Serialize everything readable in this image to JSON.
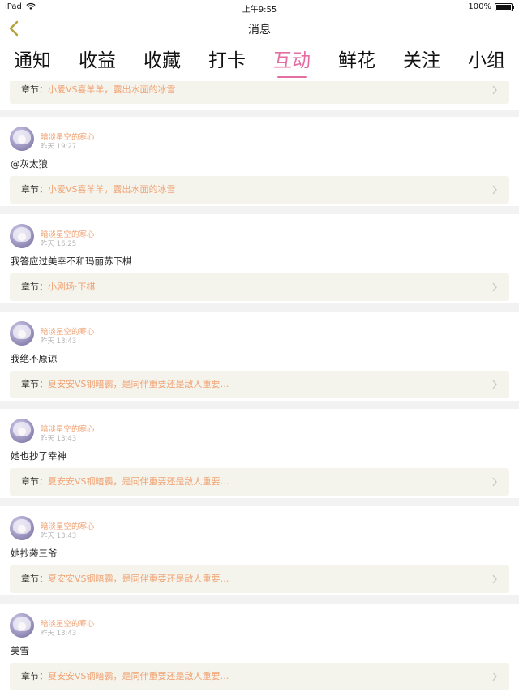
{
  "status_bar": {
    "carrier": "iPad",
    "time": "上午9:55",
    "battery": "100%"
  },
  "nav": {
    "title": "消息",
    "back_icon": "chevron-left-icon"
  },
  "tabs": [
    {
      "label": "通知",
      "active": false
    },
    {
      "label": "收益",
      "active": false
    },
    {
      "label": "收藏",
      "active": false
    },
    {
      "label": "打卡",
      "active": false
    },
    {
      "label": "互动",
      "active": true
    },
    {
      "label": "鲜花",
      "active": false
    },
    {
      "label": "关注",
      "active": false
    },
    {
      "label": "小组",
      "active": false
    }
  ],
  "colors": {
    "accent": "#e46ea1",
    "chapter_text": "#f0a273",
    "chapter_bg": "#f5f4ec"
  },
  "partial_card": {
    "chapter_prefix": "章节：",
    "chapter_name": "小爱VS喜羊羊，露出水面的冰雪"
  },
  "messages": [
    {
      "username": "暗淡星空的寒心",
      "time": "昨天 19:27",
      "content": "@灰太狼",
      "chapter_prefix": "章节：",
      "chapter_name": "小爱VS喜羊羊，露出水面的冰雪"
    },
    {
      "username": "暗淡星空的寒心",
      "time": "昨天 16:25",
      "content": "我答应过美幸不和玛丽苏下棋",
      "chapter_prefix": "章节：",
      "chapter_name": "小剧场·下棋"
    },
    {
      "username": "暗淡星空的寒心",
      "time": "昨天 13:43",
      "content": "我绝不原谅",
      "chapter_prefix": "章节：",
      "chapter_name": "夏安安VS钢暗霸，是同伴重要还是敌人重要…"
    },
    {
      "username": "暗淡星空的寒心",
      "time": "昨天 13:43",
      "content": "她也抄了幸神",
      "chapter_prefix": "章节：",
      "chapter_name": "夏安安VS钢暗霸，是同伴重要还是敌人重要…"
    },
    {
      "username": "暗淡星空的寒心",
      "time": "昨天 13:43",
      "content": "她抄袭三爷",
      "chapter_prefix": "章节：",
      "chapter_name": "夏安安VS钢暗霸，是同伴重要还是敌人重要…"
    },
    {
      "username": "暗淡星空的寒心",
      "time": "昨天 13:43",
      "content": "美雪",
      "chapter_prefix": "章节：",
      "chapter_name": "夏安安VS钢暗霸，是同伴重要还是敌人重要…"
    }
  ]
}
